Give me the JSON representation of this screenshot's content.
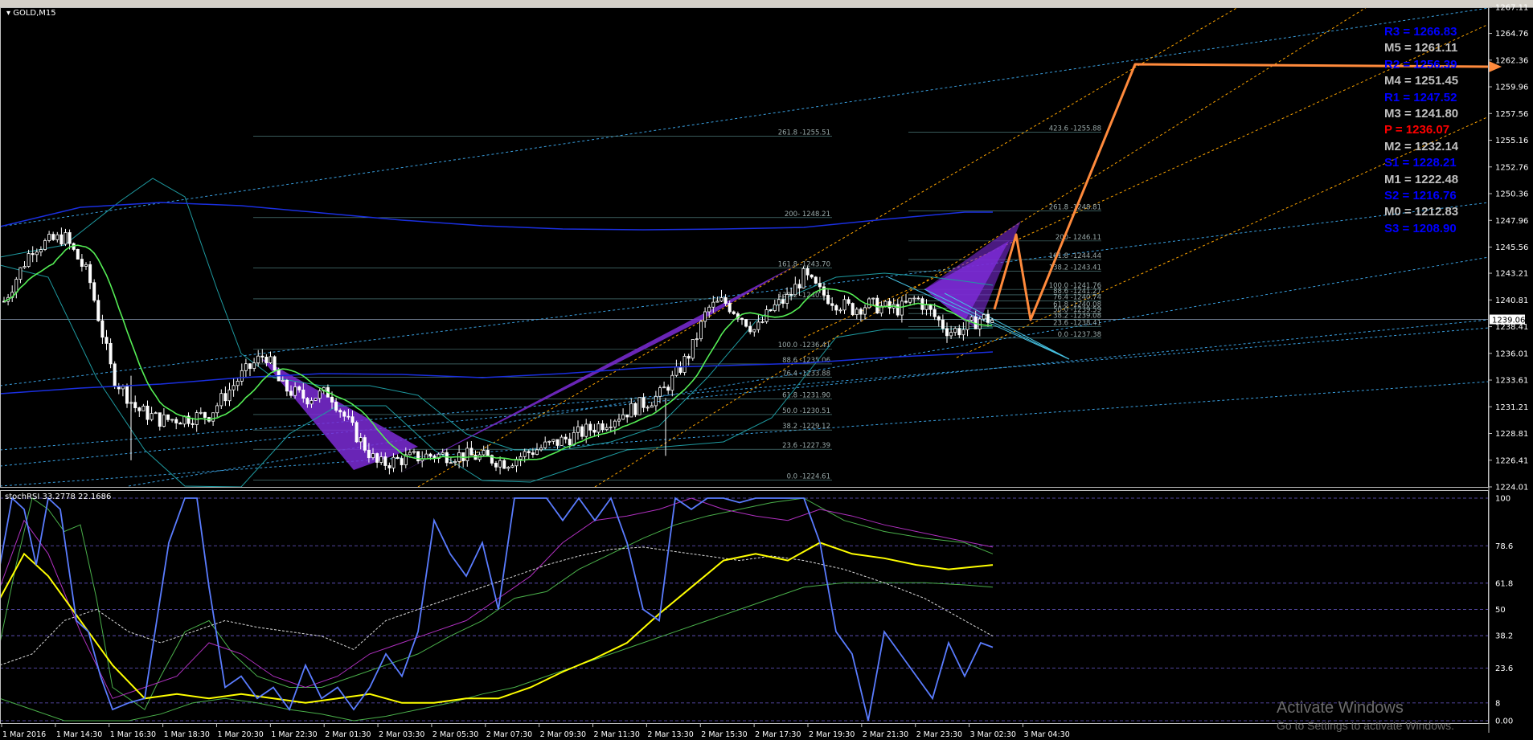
{
  "window": {
    "symbol_title": "GOLD,M15",
    "indicator_title": "stochRSI 33.2778 22.1686"
  },
  "price_axis": {
    "min": 1224.01,
    "max": 1267.11,
    "ticks": [
      "1267.11",
      "1264.76",
      "1262.36",
      "1259.96",
      "1257.56",
      "1255.16",
      "1252.76",
      "1250.36",
      "1247.96",
      "1245.56",
      "1243.21",
      "1240.81",
      "1238.41",
      "1236.01",
      "1233.61",
      "1231.21",
      "1228.81",
      "1226.41",
      "1224.01"
    ],
    "current_price": "1239.06",
    "current_price_value": 1239.06
  },
  "indicator_axis": {
    "ticks": [
      "100",
      "78.6",
      "61.8",
      "50",
      "38.2",
      "23.6",
      "8",
      "0.00"
    ],
    "tick_values": [
      100,
      78.6,
      61.8,
      50,
      38.2,
      23.6,
      8,
      0
    ]
  },
  "time_axis": {
    "labels": [
      "1 Mar 2016",
      "1 Mar 14:30",
      "1 Mar 16:30",
      "1 Mar 18:30",
      "1 Mar 20:30",
      "1 Mar 22:30",
      "2 Mar 01:30",
      "2 Mar 03:30",
      "2 Mar 05:30",
      "2 Mar 07:30",
      "2 Mar 09:30",
      "2 Mar 11:30",
      "2 Mar 13:30",
      "2 Mar 15:30",
      "2 Mar 17:30",
      "2 Mar 19:30",
      "2 Mar 21:30",
      "2 Mar 23:30",
      "3 Mar 02:30",
      "3 Mar 04:30"
    ]
  },
  "pivot_levels": [
    {
      "label": "R3 = 1266.83",
      "color": "#0000ff"
    },
    {
      "label": "M5 = 1261.11",
      "color": "#c0c0c0"
    },
    {
      "label": "R2 = 1256.39",
      "color": "#0000ff"
    },
    {
      "label": "M4 = 1251.45",
      "color": "#c0c0c0"
    },
    {
      "label": "R1 = 1247.52",
      "color": "#0000ff"
    },
    {
      "label": "M3 = 1241.80",
      "color": "#c0c0c0"
    },
    {
      "label": "P   = 1236.07",
      "color": "#ff0000"
    },
    {
      "label": "M2 = 1232.14",
      "color": "#c0c0c0"
    },
    {
      "label": "S1 = 1228.21",
      "color": "#0000ff"
    },
    {
      "label": "M1 = 1222.48",
      "color": "#c0c0c0"
    },
    {
      "label": "S2 = 1216.76",
      "color": "#0000ff"
    },
    {
      "label": "M0 = 1212.83",
      "color": "#c0c0c0"
    },
    {
      "label": "S3 = 1208.90",
      "color": "#0000ff"
    }
  ],
  "fib_left": {
    "labels": [
      "261.8 -1255.51",
      "200- 1248.21",
      "161.8 -1243.70",
      "138.2 -1240.91",
      "100.0 -1236.41",
      "88.6 -1235.06",
      "76.4 -1233.88",
      "61.8 -1231.90",
      "50.0 -1230.51",
      "38.2 -1229.12",
      "23.6 -1227.39",
      "0.0 -1224.61"
    ],
    "prices": [
      1255.51,
      1248.21,
      1243.7,
      1240.91,
      1236.41,
      1235.06,
      1233.88,
      1231.9,
      1230.51,
      1229.12,
      1227.39,
      1224.61
    ]
  },
  "fib_right": {
    "labels": [
      "423.6 -1255.88",
      "261.8 -1248.81",
      "200- 1246.11",
      "161.8 -1244.44",
      "138.2 -1243.41",
      "100.0 -1241.76",
      "88.6 -1241.27",
      "76.4 -1240.74",
      "61.8 -1240.08",
      "50.0 -1239.59",
      "38.2 -1239.08",
      "23.6 -1238.41",
      "0.0 -1237.38"
    ],
    "prices": [
      1255.88,
      1248.81,
      1246.11,
      1244.44,
      1243.41,
      1241.76,
      1241.27,
      1240.74,
      1240.08,
      1239.59,
      1239.08,
      1238.41,
      1237.38
    ]
  },
  "colors": {
    "candle": "#ffffff",
    "ma_green": "#55ee55",
    "ma_blue": "#1a2fe0",
    "bands": "#1e9aa0",
    "channel": "#3aa0e0",
    "fib_channel": "#ffa500",
    "pattern": "#7b2bd6",
    "projection": "#ff8a3c",
    "stoch_k": "#5a7cff",
    "stoch_d": "#ffff00",
    "grid_level": "#6a5acd"
  },
  "watermark": {
    "title": "Activate Windows",
    "subtitle": "Go to Settings to activate Windows."
  }
}
